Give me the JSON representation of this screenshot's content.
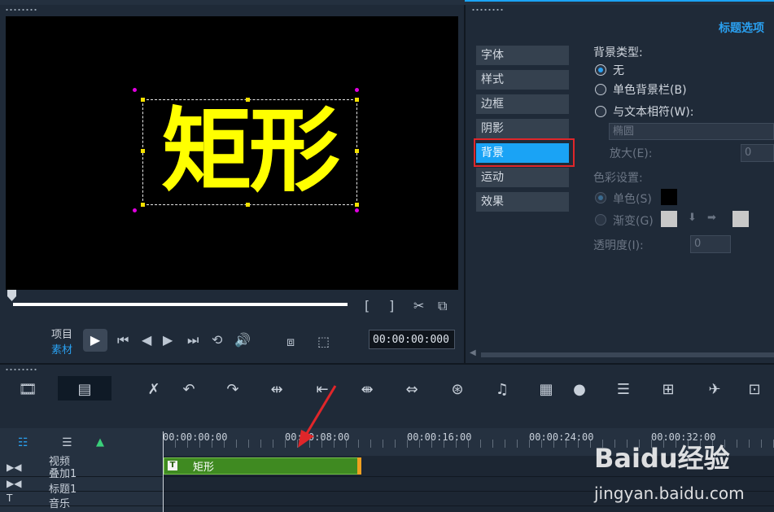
{
  "preview": {
    "title_text": "矩形",
    "project_label": "项目",
    "material_label": "素材",
    "timecode": "00:00:00:000",
    "icons": [
      "play-icon",
      "prev-icon",
      "step-back-icon",
      "step-forward-icon",
      "next-icon",
      "repeat-icon",
      "volume-icon",
      "scissors-icon",
      "copy-icon"
    ]
  },
  "options": {
    "panel_title": "标题选项",
    "tabs": [
      {
        "label": "字体"
      },
      {
        "label": "样式"
      },
      {
        "label": "边框"
      },
      {
        "label": "阴影"
      },
      {
        "label": "背景",
        "selected": true
      },
      {
        "label": "运动"
      },
      {
        "label": "效果"
      }
    ],
    "bg_type_label": "背景类型:",
    "radio_none": "无",
    "radio_solid_bar": "单色背景栏(B)",
    "radio_fit_text": "与文本相符(W):",
    "shape_value": "椭圆",
    "zoom_label": "放大(E):",
    "zoom_value": "0",
    "color_settings_label": "色彩设置:",
    "radio_single_color": "单色(S)",
    "radio_gradient": "渐变(G)",
    "opacity_label": "透明度(I):",
    "opacity_value": "0"
  },
  "timeline": {
    "ticks": [
      "00:00:00:00",
      "00:00:08:00",
      "00:00:16:00",
      "00:00:24:00",
      "00:00:32:00"
    ],
    "tracks": [
      "视频",
      "叠加1",
      "标题1",
      "音乐"
    ],
    "clip_label": "矩形"
  },
  "watermark": {
    "brand": "Baidu经验",
    "url": "jingyan.baidu.com"
  },
  "colors": {
    "accent": "#1aa3f5",
    "title_yellow": "#ffff00",
    "highlight": "#e0262a",
    "clip_green": "#3f8a21"
  }
}
